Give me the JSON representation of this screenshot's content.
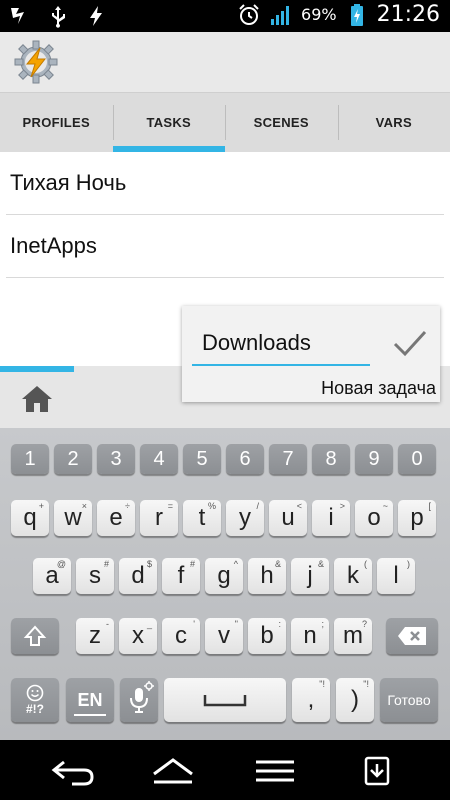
{
  "status": {
    "battery_percent": "69%",
    "time": "21:26"
  },
  "tabs": [
    {
      "label": "PROFILES",
      "active": false
    },
    {
      "label": "TASKS",
      "active": true
    },
    {
      "label": "SCENES",
      "active": false
    },
    {
      "label": "VARS",
      "active": false
    }
  ],
  "tasks": [
    "Тихая Ночь",
    "InetApps"
  ],
  "dialog": {
    "input_value": "Downloads",
    "hint": "Новая задача"
  },
  "keyboard": {
    "numbers": [
      "1",
      "2",
      "3",
      "4",
      "5",
      "6",
      "7",
      "8",
      "9",
      "0"
    ],
    "row1": [
      {
        "k": "q",
        "s": "+"
      },
      {
        "k": "w",
        "s": "×"
      },
      {
        "k": "e",
        "s": "÷"
      },
      {
        "k": "r",
        "s": "="
      },
      {
        "k": "t",
        "s": "%"
      },
      {
        "k": "y",
        "s": "/"
      },
      {
        "k": "u",
        "s": "<"
      },
      {
        "k": "i",
        "s": ">"
      },
      {
        "k": "o",
        "s": "~"
      },
      {
        "k": "p",
        "s": "["
      }
    ],
    "row2": [
      {
        "k": "a",
        "s": "@"
      },
      {
        "k": "s",
        "s": "#"
      },
      {
        "k": "d",
        "s": "$"
      },
      {
        "k": "f",
        "s": "#"
      },
      {
        "k": "g",
        "s": "^"
      },
      {
        "k": "h",
        "s": "&"
      },
      {
        "k": "j",
        "s": "&"
      },
      {
        "k": "k",
        "s": "("
      },
      {
        "k": "l",
        "s": ")"
      }
    ],
    "row3": [
      {
        "k": "z",
        "s": "-"
      },
      {
        "k": "x",
        "s": "_"
      },
      {
        "k": "c",
        "s": "'"
      },
      {
        "k": "v",
        "s": "\""
      },
      {
        "k": "b",
        "s": ":"
      },
      {
        "k": "n",
        "s": ";"
      },
      {
        "k": "m",
        "s": "?"
      }
    ],
    "emoji_label": "#!?",
    "lang_label": "EN",
    "comma_label": ",",
    "comma_sub": "\"!",
    "period_label": ")",
    "period_sub": "\"!",
    "done_label": "Готово"
  },
  "colors": {
    "accent": "#33b5e5",
    "tab_bg": "#dcdcdc",
    "keyboard_bg": "#c7c9cc"
  }
}
